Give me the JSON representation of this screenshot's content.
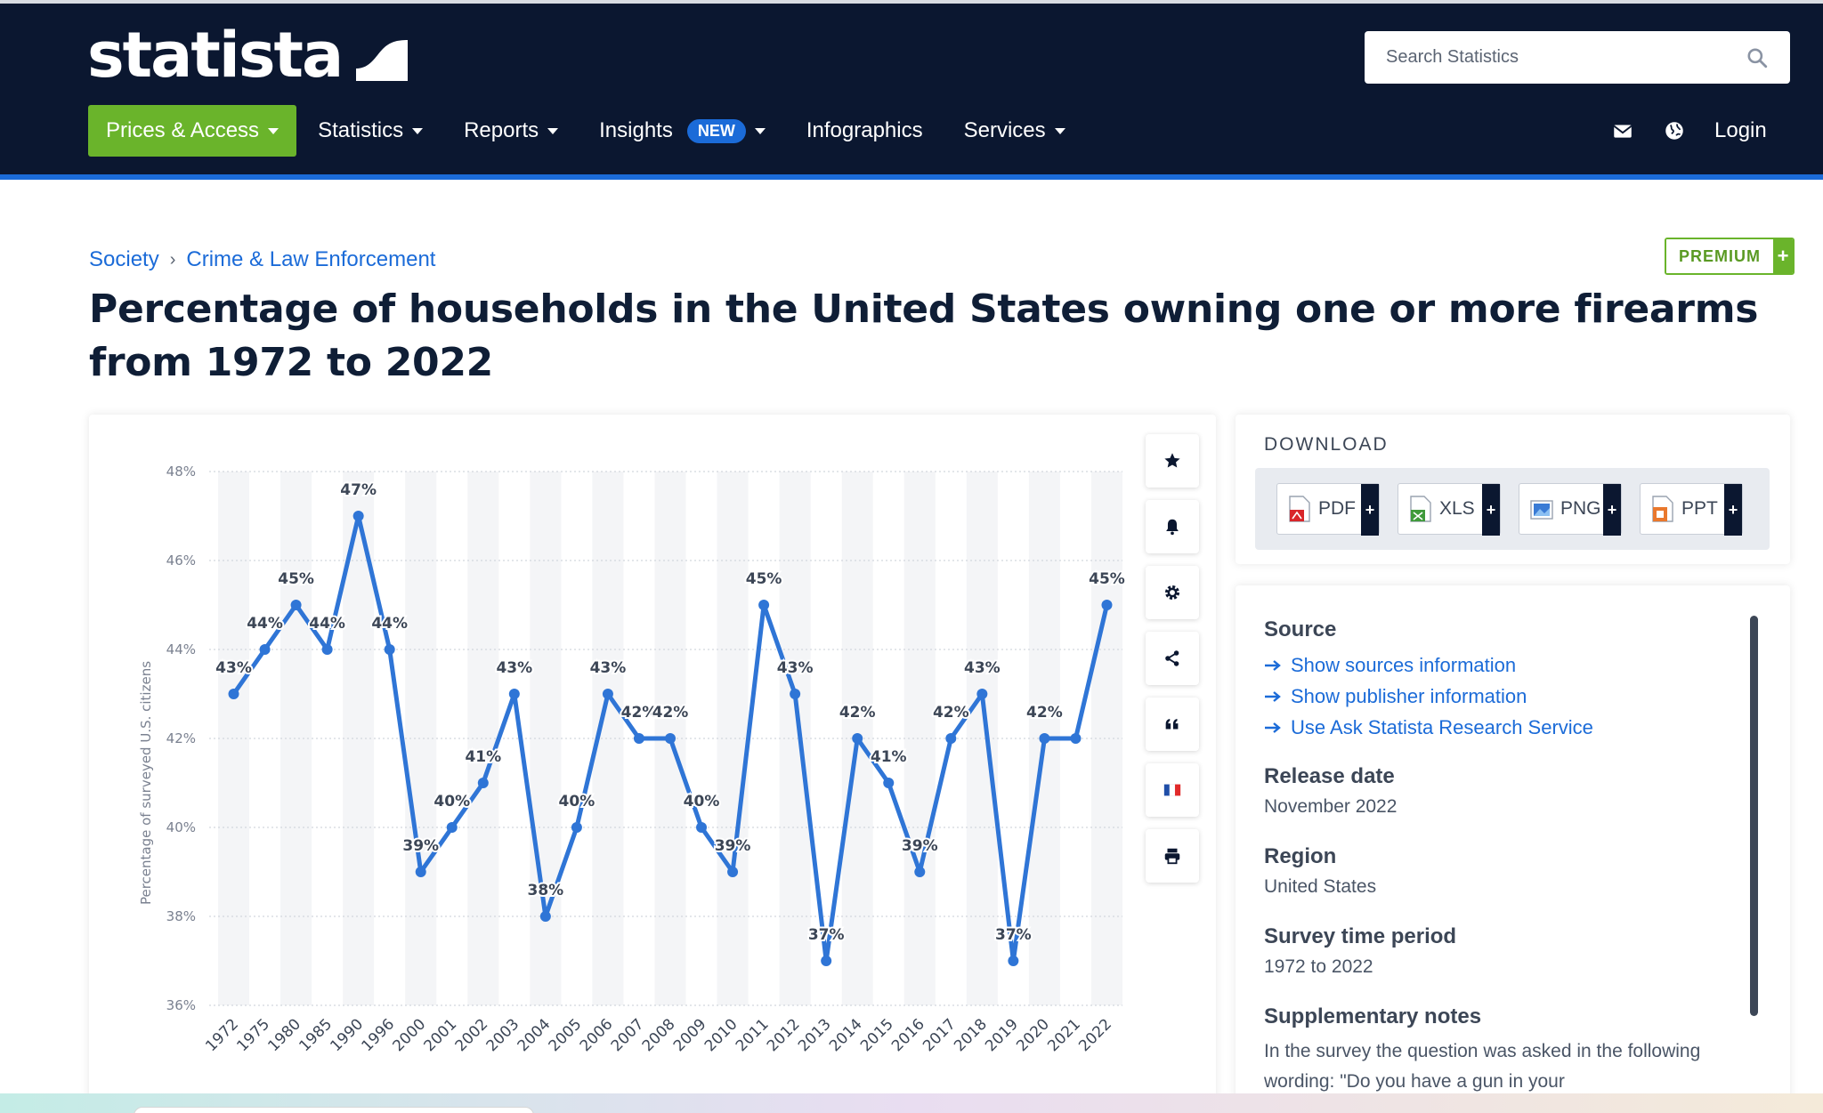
{
  "header": {
    "logo_text": "statista",
    "search_placeholder": "Search Statistics",
    "nav": [
      {
        "label": "Prices & Access"
      },
      {
        "label": "Statistics"
      },
      {
        "label": "Reports"
      },
      {
        "label": "Insights",
        "badge": "NEW"
      },
      {
        "label": "Infographics"
      },
      {
        "label": "Services"
      }
    ],
    "login": "Login",
    "icons": [
      "mail-icon",
      "globe-icon",
      "search-icon"
    ]
  },
  "breadcrumb": {
    "items": [
      "Society",
      "Crime & Law Enforcement"
    ],
    "separator": "›"
  },
  "premium": {
    "label": "PREMIUM",
    "plus": "+"
  },
  "page_title": "Percentage of households in the United States owning one or more firearms from 1972 to 2022",
  "chart_tools": [
    "star-icon",
    "bell-icon",
    "gear-icon",
    "share-icon",
    "quote-icon",
    "flag-icon",
    "print-icon"
  ],
  "download": {
    "title": "DOWNLOAD",
    "formats": [
      {
        "label": "PDF",
        "color": "#d9262a"
      },
      {
        "label": "XLS",
        "color": "#3f9a3a"
      },
      {
        "label": "PNG",
        "color": "#3a7bd5"
      },
      {
        "label": "PPT",
        "color": "#e9782d"
      }
    ],
    "plus": "+"
  },
  "info": {
    "source_heading": "Source",
    "source_links": [
      "Show sources information",
      "Show publisher information",
      "Use Ask Statista Research Service"
    ],
    "release_heading": "Release date",
    "release_value": "November 2022",
    "region_heading": "Region",
    "region_value": "United States",
    "survey_heading": "Survey time period",
    "survey_value": "1972 to 2022",
    "notes_heading": "Supplementary notes",
    "notes_text": "In the survey the question was asked in the following wording: \"Do you have a gun in your"
  },
  "chart_data": {
    "type": "line",
    "categories": [
      "1972",
      "1975",
      "1980",
      "1985",
      "1990",
      "1996",
      "2000",
      "2001",
      "2002",
      "2003",
      "2004",
      "2005",
      "2006",
      "2007",
      "2008",
      "2009",
      "2010",
      "2011",
      "2012",
      "2013",
      "2014",
      "2015",
      "2016",
      "2017",
      "2018",
      "2019",
      "2020",
      "2021",
      "2022"
    ],
    "values": [
      43,
      44,
      45,
      44,
      47,
      44,
      39,
      40,
      41,
      43,
      38,
      40,
      43,
      42,
      42,
      40,
      39,
      45,
      43,
      37,
      42,
      41,
      39,
      42,
      43,
      37,
      42,
      42,
      45
    ],
    "data_labels": [
      "43%",
      "44%",
      "45%",
      "44%",
      "47%",
      "44%",
      "39%",
      "40%",
      "41%",
      "43%",
      "38%",
      "40%",
      "43%",
      "42%",
      "42%",
      "40%",
      "39%",
      "45%",
      "43%",
      "37%",
      "42%",
      "41%",
      "39%",
      "42%",
      "43%",
      "37%",
      "42%",
      "",
      "45%"
    ],
    "ylabel": "Percentage of surveyed U.S. citizens",
    "ylim": [
      36,
      48
    ],
    "yticks": [
      36,
      38,
      40,
      42,
      44,
      46,
      48
    ],
    "ytick_labels": [
      "36%",
      "38%",
      "40%",
      "42%",
      "44%",
      "46%",
      "48%"
    ],
    "grid": true,
    "line_color": "#2f75d6"
  }
}
